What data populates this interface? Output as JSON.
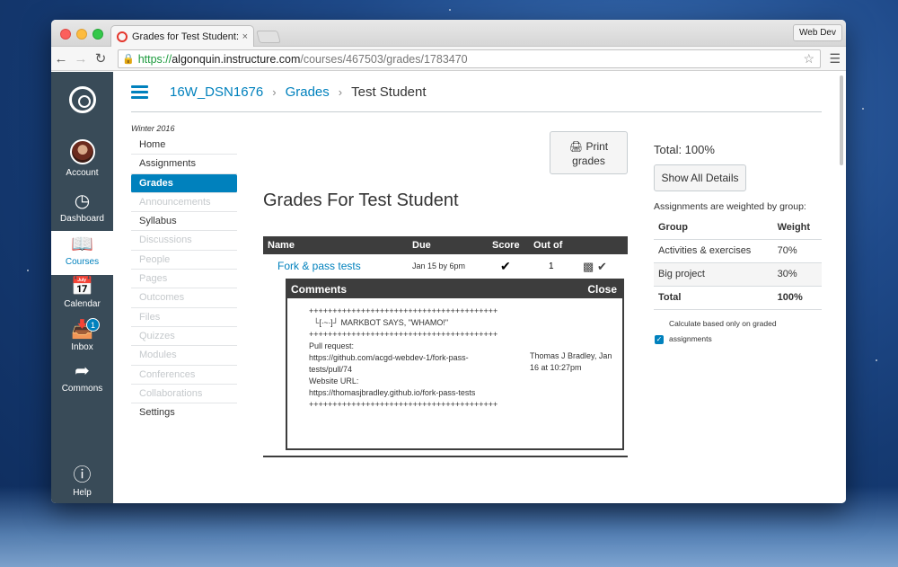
{
  "browser": {
    "tab_title": "Grades for Test Student: W",
    "tab_close": "×",
    "profile": "Web Dev",
    "url_proto": "https://",
    "url_host": "algonquin.instructure.com",
    "url_path": "/courses/467503/grades/1783470"
  },
  "global_nav": {
    "items": [
      {
        "label": "Account",
        "icon": "avatar"
      },
      {
        "label": "Dashboard",
        "icon": "gauge-icon"
      },
      {
        "label": "Courses",
        "icon": "book-icon",
        "active": true
      },
      {
        "label": "Calendar",
        "icon": "calendar-icon"
      },
      {
        "label": "Inbox",
        "icon": "inbox-icon",
        "badge": "1"
      },
      {
        "label": "Commons",
        "icon": "share-arrow-icon"
      },
      {
        "label": "Help",
        "icon": "question-icon"
      }
    ]
  },
  "breadcrumb": {
    "course": "16W_DSN1676",
    "section": "Grades",
    "current": "Test Student"
  },
  "course_nav": {
    "term": "Winter 2016",
    "items": [
      "Home",
      "Assignments",
      "Grades",
      "Announcements",
      "Syllabus",
      "Discussions",
      "People",
      "Pages",
      "Outcomes",
      "Files",
      "Quizzes",
      "Modules",
      "Conferences",
      "Collaborations",
      "Settings"
    ]
  },
  "main": {
    "print_label_1": "Print",
    "print_label_2": "grades",
    "title": "Grades For Test Student",
    "columns": {
      "name": "Name",
      "due": "Due",
      "score": "Score",
      "out_of": "Out of"
    },
    "row": {
      "name": "Fork & pass tests",
      "due": "Jan 15 by 6pm",
      "score": "✔",
      "out_of": "1"
    },
    "comments": {
      "header": "Comments",
      "close": "Close",
      "lines": [
        "++++++++++++++++++++++++++++++++++++++++",
        "  └[∙~∙]┘ MARKBOT SAYS, \"WHAMO!\"",
        "++++++++++++++++++++++++++++++++++++++++",
        "",
        "Pull request:",
        "https://github.com/acgd-webdev-1/fork-pass-",
        "tests/pull/74",
        "",
        "Website URL:",
        "https://thomasjbradley.github.io/fork-pass-tests",
        "",
        "++++++++++++++++++++++++++++++++++++++++"
      ],
      "author": "Thomas J Bradley, Jan 16 at 10:27pm"
    }
  },
  "sidebar": {
    "total": "Total: 100%",
    "show_details": "Show All Details",
    "weighted_note": "Assignments are weighted by group:",
    "table_head": {
      "group": "Group",
      "weight": "Weight"
    },
    "rows": [
      {
        "group": "Activities & exercises",
        "weight": "70%"
      },
      {
        "group": "Big project",
        "weight": "30%"
      },
      {
        "group": "Total",
        "weight": "100%"
      }
    ],
    "calc_note_1": "Calculate based only on graded",
    "calc_note_2": "assignments"
  }
}
